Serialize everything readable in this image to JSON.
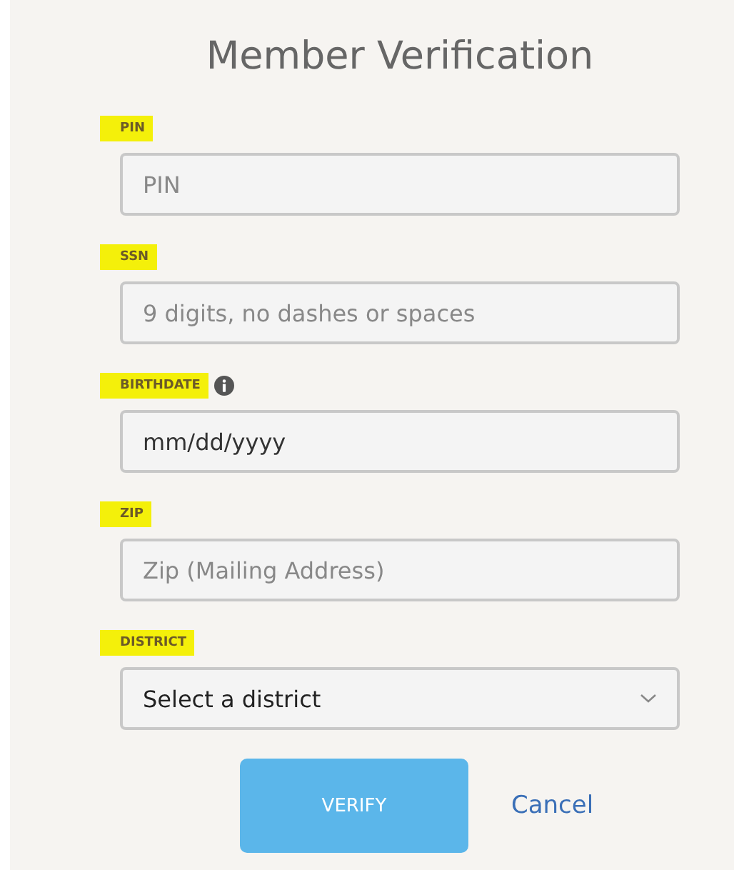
{
  "title": "Member Verification",
  "fields": [
    {
      "kind": "text",
      "label": "PIN",
      "highlighted": true,
      "info": false,
      "placeholder": "PIN"
    },
    {
      "kind": "text",
      "label": "SSN",
      "highlighted": true,
      "info": false,
      "placeholder": "9 digits, no dashes or spaces"
    },
    {
      "kind": "text",
      "label": "BIRTHDATE",
      "highlighted": true,
      "info": true,
      "value": "mm/dd/yyyy"
    },
    {
      "kind": "text",
      "label": "ZIP",
      "highlighted": true,
      "info": false,
      "placeholder": "Zip (Mailing Address)"
    },
    {
      "kind": "select",
      "label": "DISTRICT",
      "highlighted": true,
      "info": false,
      "value": "Select a district"
    }
  ],
  "buttons": {
    "primary": "VERIFY",
    "secondary": "Cancel"
  }
}
